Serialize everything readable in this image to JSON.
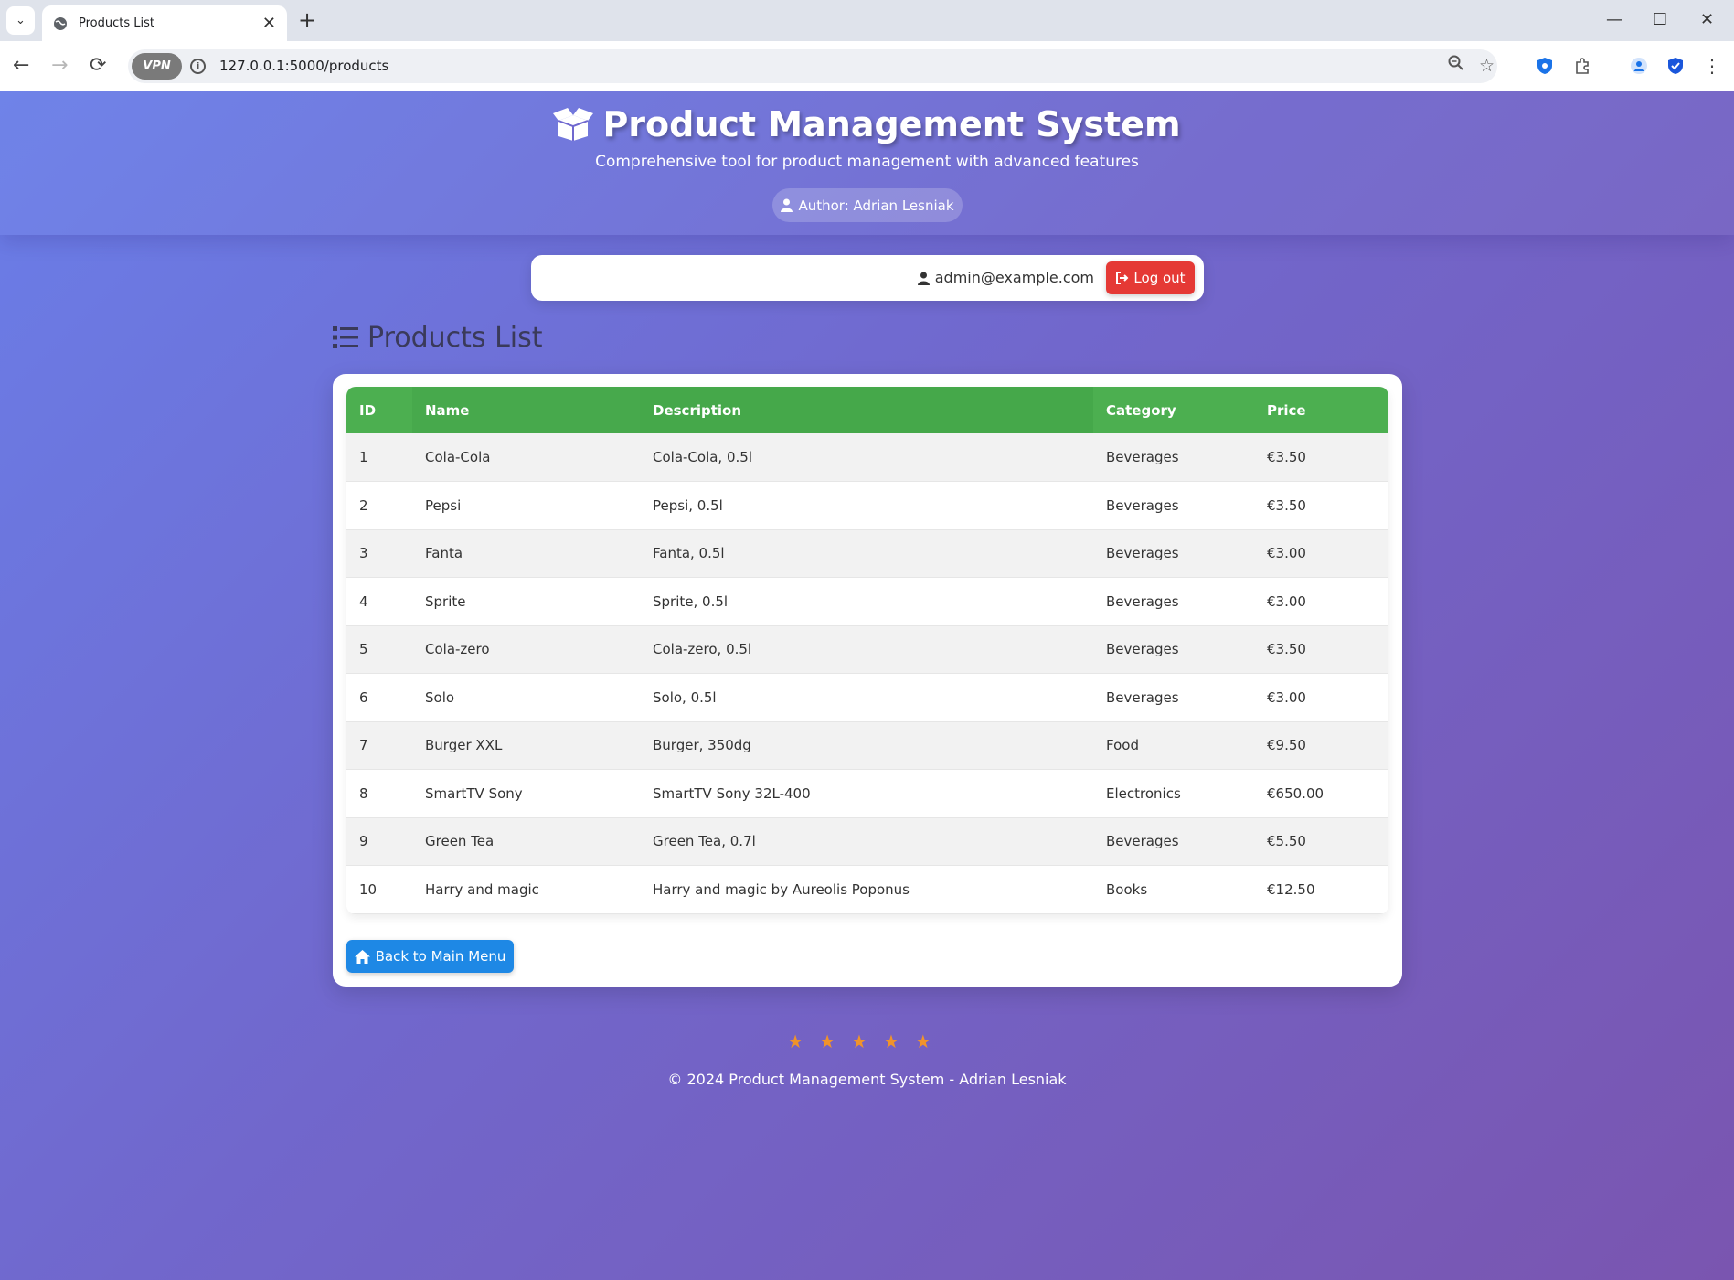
{
  "browser": {
    "tab_title": "Products List",
    "url": "127.0.0.1:5000/products",
    "vpn_label": "VPN",
    "info_glyph": "i"
  },
  "hero": {
    "title": "Product Management System",
    "subtitle": "Comprehensive tool for product management with advanced features",
    "author": "Author: Adrian Lesniak"
  },
  "userbar": {
    "email": "admin@example.com",
    "logout_label": "Log out"
  },
  "page_title": "Products List",
  "table": {
    "headers": [
      "ID",
      "Name",
      "Description",
      "Category",
      "Price"
    ],
    "rows": [
      [
        "1",
        "Cola-Cola",
        "Cola-Cola, 0.5l",
        "Beverages",
        "€3.50"
      ],
      [
        "2",
        "Pepsi",
        "Pepsi, 0.5l",
        "Beverages",
        "€3.50"
      ],
      [
        "3",
        "Fanta",
        "Fanta, 0.5l",
        "Beverages",
        "€3.00"
      ],
      [
        "4",
        "Sprite",
        "Sprite, 0.5l",
        "Beverages",
        "€3.00"
      ],
      [
        "5",
        "Cola-zero",
        "Cola-zero, 0.5l",
        "Beverages",
        "€3.50"
      ],
      [
        "6",
        "Solo",
        "Solo, 0.5l",
        "Beverages",
        "€3.00"
      ],
      [
        "7",
        "Burger XXL",
        "Burger, 350dg",
        "Food",
        "€9.50"
      ],
      [
        "8",
        "SmartTV Sony",
        "SmartTV Sony 32L-400",
        "Electronics",
        "€650.00"
      ],
      [
        "9",
        "Green Tea",
        "Green Tea, 0.7l",
        "Beverages",
        "€5.50"
      ],
      [
        "10",
        "Harry and magic",
        "Harry and magic by Aureolis Poponus",
        "Books",
        "€12.50"
      ]
    ]
  },
  "back_button_label": "Back to Main Menu",
  "footer": {
    "stars": "★★★★★",
    "text": "© 2024 Product Management System - Adrian Lesniak"
  },
  "colors": {
    "header_green": "#4caf50",
    "logout_red": "#e53935",
    "back_blue": "#1e88e5",
    "star_orange": "#f0932b"
  }
}
